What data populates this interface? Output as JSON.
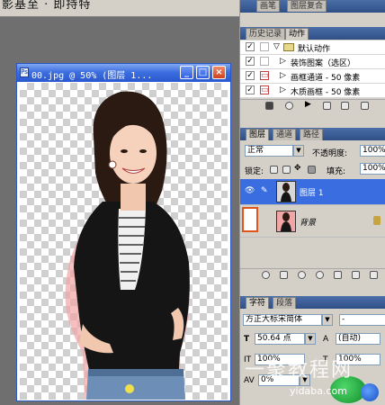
{
  "background_titles": {
    "left_strip": "影基至 · 即持特",
    "right_tabs": [
      "画笔",
      "图层复合"
    ]
  },
  "document": {
    "title": "00.jpg @ 50% (图层 1...",
    "buttons": {
      "minimize": "_",
      "maximize": "□",
      "close": "×"
    }
  },
  "actions_panel": {
    "tabs": [
      "历史记录",
      "动作"
    ],
    "active_tab": "动作",
    "set_name": "默认动作",
    "items": [
      "装饰图案（选区）",
      "画框通道 - 50 像素",
      "木质画框 - 50 像素"
    ]
  },
  "layers_panel": {
    "tabs": [
      "图层",
      "通道",
      "路径"
    ],
    "active_tab": "图层",
    "blend_mode": "正常",
    "opacity_label": "不透明度:",
    "opacity_value": "100%",
    "lock_label": "锁定:",
    "fill_label": "填充:",
    "fill_value": "100%",
    "layers": [
      {
        "name": "图层 1",
        "selected": true,
        "visible": true
      },
      {
        "name": "背景",
        "selected": false,
        "visible": false
      }
    ],
    "highlight_color": "#e0541e"
  },
  "character_panel": {
    "tabs": [
      "字符",
      "段落"
    ],
    "active_tab": "字符",
    "font_family": "方正大标宋简体",
    "font_style": "-",
    "font_size": "50.64 点",
    "leading": "(自动)",
    "vertical_scale": "100%",
    "horizontal_scale": "100%",
    "tracking": "0%"
  },
  "watermark": {
    "text": "一聚教程网",
    "url": "yidaba.com"
  },
  "colors": {
    "selection_blue": "#3a6ee0",
    "title_blue": "#2a58cf"
  }
}
